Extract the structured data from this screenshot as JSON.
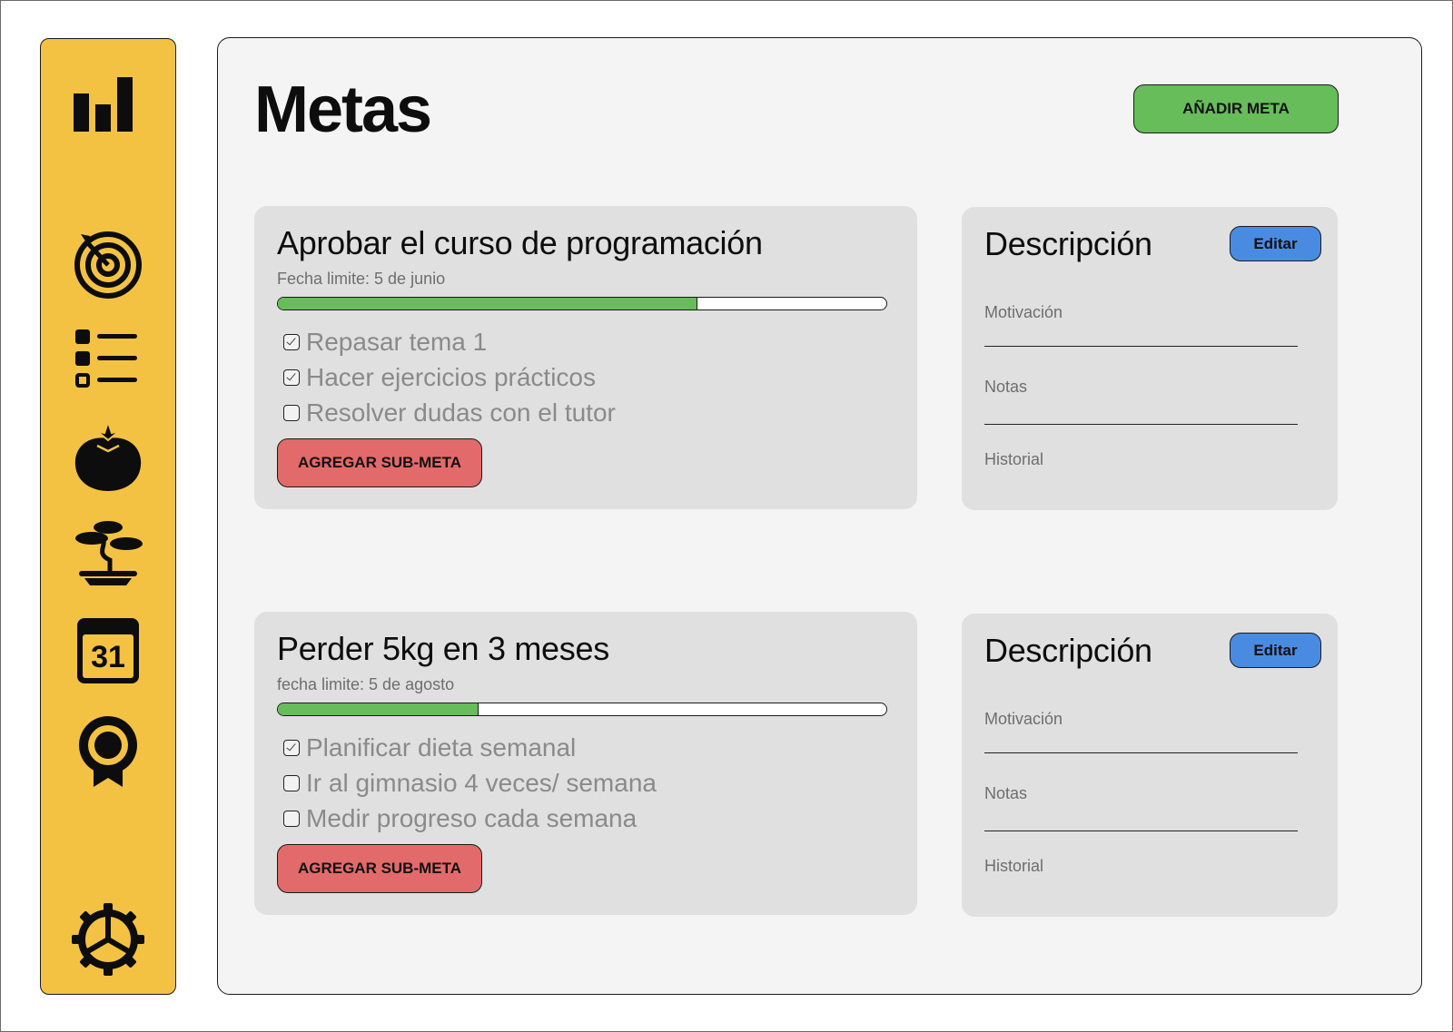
{
  "sidebar": {
    "accent": "#F4C242",
    "items": [
      {
        "icon": "bar-chart-icon"
      },
      {
        "icon": "target-icon"
      },
      {
        "icon": "list-icon"
      },
      {
        "icon": "tomato-icon"
      },
      {
        "icon": "bonsai-icon"
      },
      {
        "icon": "calendar-icon",
        "text": "31"
      },
      {
        "icon": "award-icon"
      },
      {
        "icon": "gear-icon"
      }
    ]
  },
  "header": {
    "title": "Metas",
    "add_button": "AÑADIR META"
  },
  "goals": [
    {
      "title": "Aprobar el curso de programación",
      "deadline": "Fecha limite: 5 de junio",
      "progress": 0.69,
      "subgoals": [
        {
          "label": "Repasar tema 1",
          "checked": true
        },
        {
          "label": "Hacer ejercicios prácticos",
          "checked": true
        },
        {
          "label": "Resolver dudas con el tutor",
          "checked": false
        }
      ],
      "add_sub_button": "AGREGAR SUB-META",
      "description": {
        "title": "Descripción",
        "edit_button": "Editar",
        "fields": [
          "Motivación",
          "Notas",
          "Historial"
        ]
      }
    },
    {
      "title": "Perder 5kg en 3 meses",
      "deadline": "fecha limite: 5 de agosto",
      "progress": 0.33,
      "subgoals": [
        {
          "label": "Planificar dieta semanal",
          "checked": true
        },
        {
          "label": "Ir al gimnasio 4 veces/ semana",
          "checked": false
        },
        {
          "label": "Medir progreso cada semana",
          "checked": false
        }
      ],
      "add_sub_button": "AGREGAR SUB-META",
      "description": {
        "title": "Descripción",
        "edit_button": "Editar",
        "fields": [
          "Motivación",
          "Notas",
          "Historial"
        ]
      }
    }
  ],
  "colors": {
    "progress": "#66BD59",
    "add_goal": "#66BD59",
    "add_sub": "#E36A6A",
    "edit": "#4A8BE2"
  }
}
